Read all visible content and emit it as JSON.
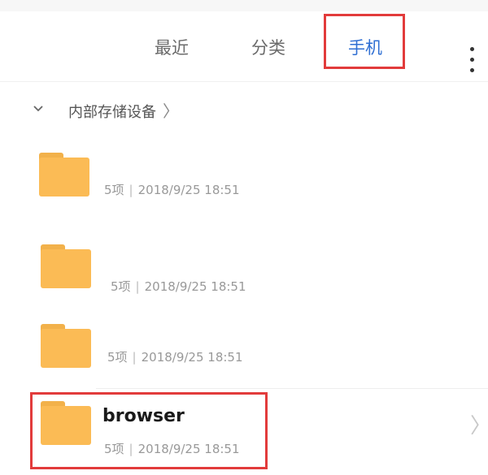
{
  "tabs": [
    {
      "label": "最近"
    },
    {
      "label": "分类"
    },
    {
      "label": "手机",
      "selected": true
    }
  ],
  "accent_color": "#2f6fd3",
  "highlight_color": "#e23b3b",
  "breadcrumb": {
    "label": "内部存储设备",
    "arrow": "〉"
  },
  "folders": [
    {
      "name": "",
      "count": "5项",
      "date": "2018/9/25 18:51"
    },
    {
      "name": "",
      "count": "5项",
      "date": "2018/9/25 18:51"
    },
    {
      "name": "",
      "count": "5项",
      "date": "2018/9/25 18:51"
    },
    {
      "name": "browser",
      "count": "5项",
      "date": "2018/9/25 18:51"
    }
  ],
  "separator": "|",
  "row_arrow": "〉"
}
